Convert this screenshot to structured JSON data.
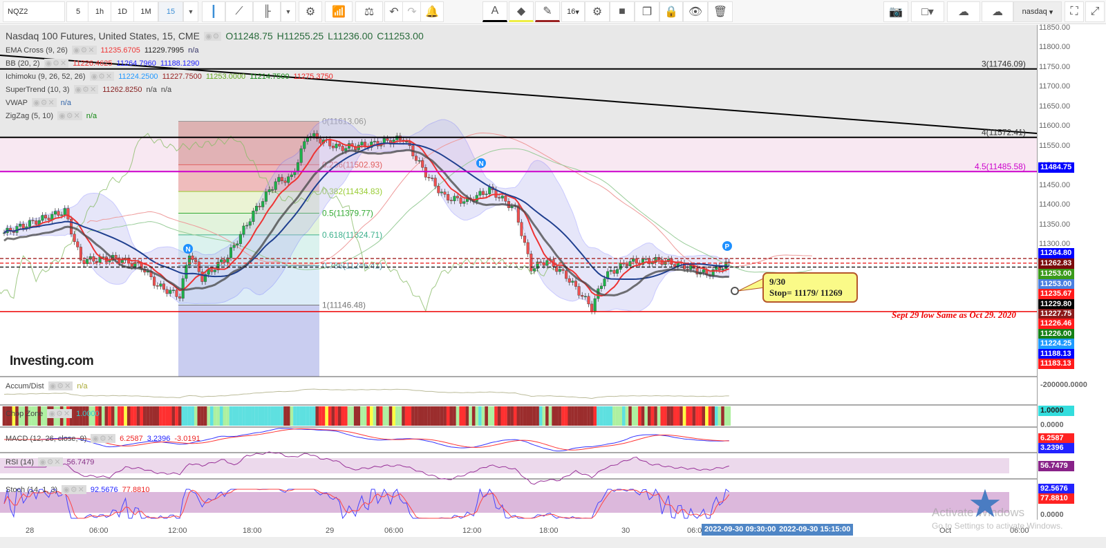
{
  "toolbar": {
    "symbol": "NQZ2",
    "intervals": [
      "5",
      "1h",
      "1D",
      "1M",
      "15"
    ],
    "selected_interval": "15",
    "font_size": "16",
    "layout_name": "nasdaq",
    "icons": [
      "candles-icon",
      "line-chart-icon",
      "bar-type-icon",
      "dropdown-icon",
      "gear-icon",
      "indicators-icon",
      "compare-icon",
      "undo-icon",
      "redo-icon",
      "alert-icon"
    ],
    "draw_icons": [
      "text-color-icon",
      "fill-icon",
      "pen-icon",
      "settings-icon",
      "style-icon",
      "clone-icon",
      "lock-icon",
      "eye-icon",
      "trash-icon"
    ],
    "right_icons": [
      "camera-icon",
      "theme-icon",
      "cloud-download-icon",
      "cloud-upload-icon"
    ]
  },
  "legend": {
    "title": "Nasdaq 100 Futures, United States, 15, CME",
    "ohlc": {
      "o": "O11248.75",
      "h": "H11255.25",
      "l": "L11236.00",
      "c": "C11253.00"
    },
    "indicators": [
      {
        "name": "EMA Cross (9, 26)",
        "values": [
          {
            "v": "11235.6705",
            "c": "#e33"
          },
          {
            "v": "11229.7995",
            "c": "#222"
          },
          {
            "v": "n/a",
            "c": "#336"
          }
        ]
      },
      {
        "name": "BB (20, 2)",
        "values": [
          {
            "v": "11226.4625",
            "c": "#e33"
          },
          {
            "v": "11264.7960",
            "c": "#22f"
          },
          {
            "v": "11188.1290",
            "c": "#22f"
          }
        ]
      },
      {
        "name": "Ichimoku (9, 26, 52, 26)",
        "values": [
          {
            "v": "11224.2500",
            "c": "#29f"
          },
          {
            "v": "11227.7500",
            "c": "#922"
          },
          {
            "v": "11253.0000",
            "c": "#6a2"
          },
          {
            "v": "11214.7500",
            "c": "#181"
          },
          {
            "v": "11275.3750",
            "c": "#e22"
          }
        ]
      },
      {
        "name": "SuperTrend (10, 3)",
        "values": [
          {
            "v": "11262.8250",
            "c": "#822"
          },
          {
            "v": "n/a",
            "c": "#444"
          },
          {
            "v": "n/a",
            "c": "#444"
          }
        ]
      },
      {
        "name": "VWAP",
        "values": [
          {
            "v": "n/a",
            "c": "#36a"
          }
        ]
      },
      {
        "name": "ZigZag (5, 10)",
        "values": [
          {
            "v": "n/a",
            "c": "#181"
          }
        ]
      }
    ]
  },
  "panes": {
    "accum": {
      "name": "Accum/Dist",
      "value": "n/a"
    },
    "chop": {
      "name": "Chop Zone",
      "value": "1.0000"
    },
    "macd": {
      "name": "MACD (12, 26, close, 9)",
      "v1": "6.2587",
      "v2": "3.2396",
      "v3": "-3.0191"
    },
    "rsi": {
      "name": "RSI (14)",
      "value": "56.7479"
    },
    "stoch": {
      "name": "Stoch (14, 1, 3)",
      "v1": "92.5676",
      "v2": "77.8810"
    }
  },
  "chart_data": {
    "type": "candlestick",
    "symbol": "NQZ2",
    "ylim": [
      11130,
      11860
    ],
    "yticks": [
      "11850.00",
      "11800.00",
      "11750.00",
      "11700.00",
      "11650.00",
      "11600.00",
      "11550.00",
      "11500.00",
      "11450.00",
      "11400.00",
      "11350.00",
      "11300.00"
    ],
    "xticks": [
      "28",
      "06:00",
      "12:00",
      "18:00",
      "29",
      "06:00",
      "12:00",
      "18:00",
      "30",
      "06:00",
      "Oct",
      "06:00"
    ],
    "price_path": [
      [
        0,
        11330
      ],
      [
        10,
        11360
      ],
      [
        19,
        11385
      ],
      [
        24,
        11260
      ],
      [
        35,
        11265
      ],
      [
        43,
        11245
      ],
      [
        48,
        11195
      ],
      [
        55,
        11170
      ],
      [
        58,
        11280
      ],
      [
        62,
        11215
      ],
      [
        70,
        11270
      ],
      [
        78,
        11380
      ],
      [
        85,
        11460
      ],
      [
        90,
        11470
      ],
      [
        95,
        11580
      ],
      [
        98,
        11570
      ],
      [
        105,
        11545
      ],
      [
        115,
        11555
      ],
      [
        125,
        11570
      ],
      [
        132,
        11480
      ],
      [
        138,
        11420
      ],
      [
        145,
        11410
      ],
      [
        152,
        11440
      ],
      [
        160,
        11390
      ],
      [
        165,
        11240
      ],
      [
        170,
        11260
      ],
      [
        176,
        11220
      ],
      [
        184,
        11140
      ],
      [
        188,
        11220
      ],
      [
        195,
        11255
      ],
      [
        205,
        11260
      ],
      [
        213,
        11245
      ],
      [
        220,
        11225
      ],
      [
        227,
        11253
      ]
    ],
    "price_tags": [
      {
        "v": "11484.75",
        "c": "#0000ff"
      },
      {
        "v": "11264.80",
        "c": "#0000ff"
      },
      {
        "v": "11262.83",
        "c": "#7a0a0a"
      },
      {
        "v": "11253.00",
        "c": "#3a9a1a"
      },
      {
        "v": "11253.00",
        "c": "#4a7fe0"
      },
      {
        "v": "11235.67",
        "c": "#ff1a1a"
      },
      {
        "v": "11229.80",
        "c": "#000000"
      },
      {
        "v": "11227.75",
        "c": "#8b1a1a"
      },
      {
        "v": "11226.46",
        "c": "#ff1a1a"
      },
      {
        "v": "11226.00",
        "c": "#158015"
      },
      {
        "v": "11224.25",
        "c": "#1e9aff"
      },
      {
        "v": "11188.13",
        "c": "#0000ff"
      },
      {
        "v": "11183.13",
        "c": "#ff1a1a"
      }
    ],
    "fib": {
      "levels": [
        {
          "r": "0",
          "label": "0(11613.06)",
          "p": 11613.06
        },
        {
          "r": "0.236",
          "label": "0.236(11502.93)",
          "p": 11502.93
        },
        {
          "r": "0.382",
          "label": "0.382(11434.83)",
          "p": 11434.83
        },
        {
          "r": "0.5",
          "label": "0.5(11379.77)",
          "p": 11379.77
        },
        {
          "r": "0.618",
          "label": "0.618(11324.71)",
          "p": 11324.71
        },
        {
          "r": "0.786",
          "label": "0.786(11246.41)",
          "p": 11246.41
        },
        {
          "r": "1",
          "label": "1(11146.48)",
          "p": 11146.48
        }
      ]
    },
    "hlines": [
      {
        "label": "3(11746.09)",
        "p": 11746.09
      },
      {
        "label": "4(11572.41)",
        "p": 11572.41
      },
      {
        "label": "4.5(11485.58)",
        "p": 11485.58
      }
    ],
    "annotations": {
      "note_line1": "9/30",
      "note_line2": "Stop= 11179/ 11269",
      "low_note": "Sept 29 low Same as Oct 29. 2020",
      "markers": [
        "N",
        "N",
        "P"
      ]
    },
    "pane_axis": {
      "accum": "-200000.0000",
      "chop": "1.0000",
      "chop_zero": "0.0000",
      "macd1": "6.2587",
      "macd2": "3.2396",
      "rsi": "56.7479",
      "stoch1": "92.5676",
      "stoch2": "77.8810",
      "stoch_zero": "0.0000"
    },
    "crosshair_dates": [
      "2022-09-30 09:30:00",
      "2022-09-30 15:15:00"
    ]
  },
  "branding": {
    "logo": "Investing.com"
  },
  "watermark": {
    "line1": "Activate Windows",
    "line2": "Go to Settings to activate Windows."
  }
}
